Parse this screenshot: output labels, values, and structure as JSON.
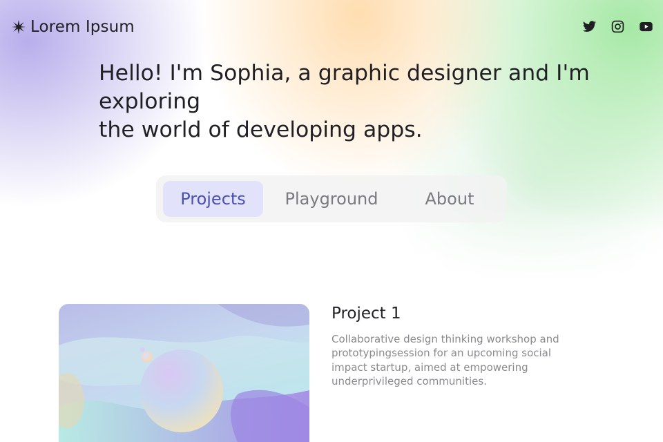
{
  "header": {
    "logo_text": "Lorem Ipsum",
    "logo_icon": "sparkle-star-icon",
    "socials": [
      {
        "name": "twitter",
        "icon": "twitter-icon"
      },
      {
        "name": "instagram",
        "icon": "instagram-icon"
      },
      {
        "name": "youtube",
        "icon": "youtube-icon"
      }
    ]
  },
  "hero": {
    "line1": "Hello! I'm Sophia, a graphic designer and I'm exploring",
    "line2": "the world of developing apps."
  },
  "tabs": [
    {
      "label": "Projects",
      "active": true
    },
    {
      "label": "Playground",
      "active": false
    },
    {
      "label": "About",
      "active": false
    }
  ],
  "project": {
    "title": "Project 1",
    "description": "Collaborative design thinking workshop and prototypingsession for an upcoming social impact startup, aimed at empowering underprivileged communities."
  },
  "colors": {
    "active_tab_bg": "#e2e2fb",
    "active_tab_text": "#4b4fb0",
    "text_primary": "#1f1f24",
    "text_muted": "#8a8a90"
  }
}
